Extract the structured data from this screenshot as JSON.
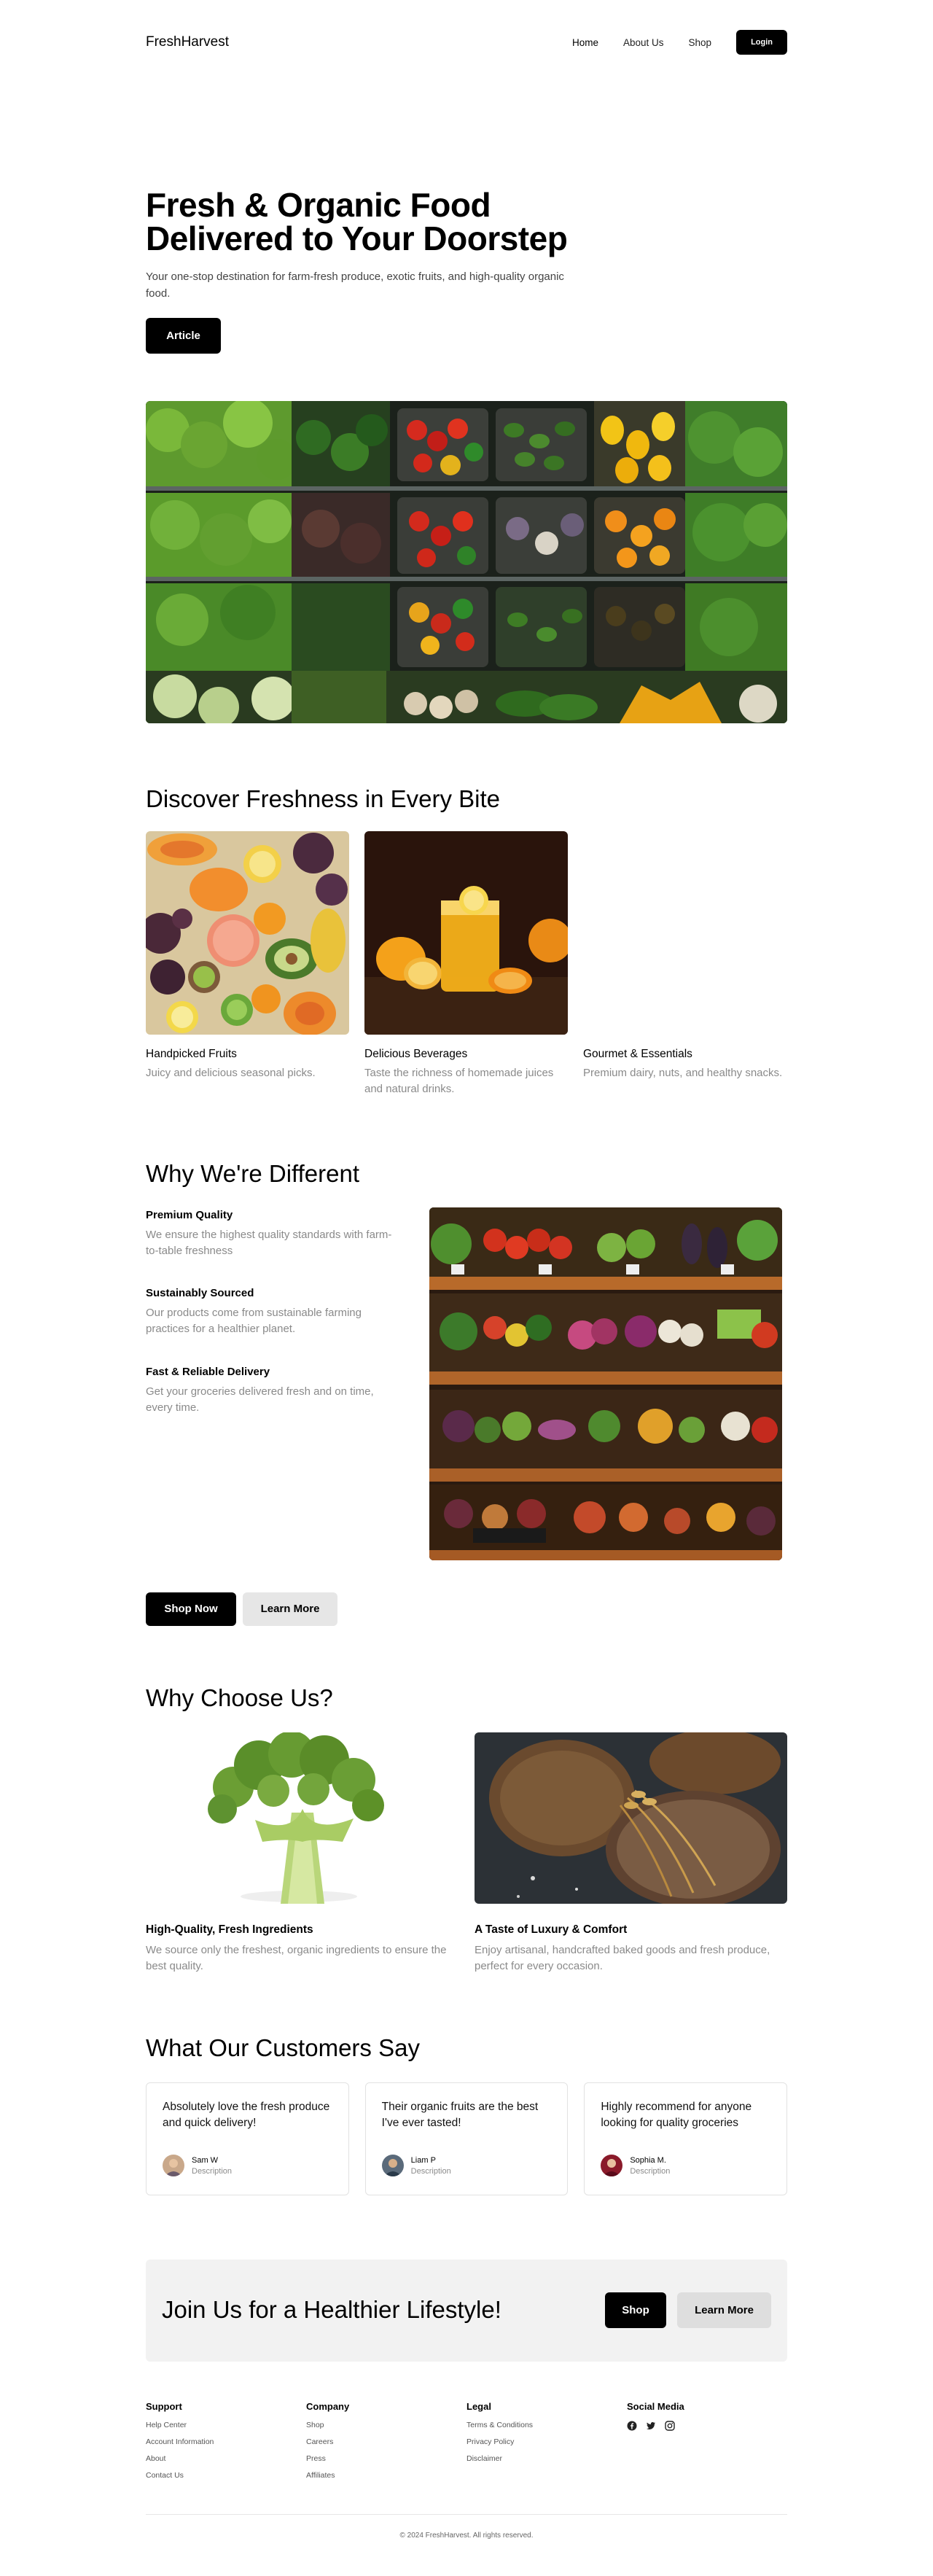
{
  "nav": {
    "brand": "FreshHarvest",
    "links": [
      "Home",
      "About Us",
      "Shop"
    ],
    "login": "Login"
  },
  "hero": {
    "title": "Fresh & Organic Food Delivered to Your Doorstep",
    "subtitle": "Your one-stop destination for farm-fresh produce, exotic fruits, and high-quality organic food.",
    "button": "Article"
  },
  "discover": {
    "heading": "Discover Freshness in Every Bite",
    "cards": [
      {
        "title": "Handpicked Fruits",
        "desc": "Juicy and delicious seasonal picks."
      },
      {
        "title": "Delicious Beverages",
        "desc": "Taste the richness of homemade juices and natural drinks."
      },
      {
        "title": "Gourmet & Essentials",
        "desc": "Premium dairy, nuts, and healthy snacks."
      }
    ]
  },
  "different": {
    "heading": "Why We're Different",
    "features": [
      {
        "title": "Premium Quality",
        "desc": "We ensure the highest quality standards with farm-to-table freshness"
      },
      {
        "title": "Sustainably Sourced",
        "desc": "Our products come from sustainable farming practices for a healthier planet."
      },
      {
        "title": "Fast & Reliable Delivery",
        "desc": "Get your groceries delivered fresh and on time, every time."
      }
    ],
    "shop_now": "Shop Now",
    "learn_more": "Learn More"
  },
  "choose": {
    "heading": "Why Choose Us?",
    "items": [
      {
        "title": "High-Quality, Fresh Ingredients",
        "desc": "We source only the freshest, organic ingredients to ensure the best quality."
      },
      {
        "title": "A Taste of Luxury & Comfort",
        "desc": "Enjoy artisanal, handcrafted baked goods and fresh produce, perfect for every occasion."
      }
    ]
  },
  "testimonials": {
    "heading": "What Our Customers Say",
    "items": [
      {
        "quote": "Absolutely love the fresh produce and quick delivery!",
        "name": "Sam W",
        "role": "Description"
      },
      {
        "quote": "Their organic fruits are the best I've ever tasted!",
        "name": "Liam P",
        "role": "Description"
      },
      {
        "quote": "Highly recommend for anyone looking for quality groceries",
        "name": "Sophia M.",
        "role": "Description"
      }
    ]
  },
  "cta": {
    "heading": "Join Us for a Healthier Lifestyle!",
    "shop": "Shop",
    "learn_more": "Learn More"
  },
  "footer": {
    "support": {
      "title": "Support",
      "links": [
        "Help Center",
        "Account Information",
        "About",
        "Contact Us"
      ]
    },
    "company": {
      "title": "Company",
      "links": [
        "Shop",
        "Careers",
        "Press",
        "Affiliates"
      ]
    },
    "legal": {
      "title": "Legal",
      "links": [
        "Terms & Conditions",
        "Privacy Policy",
        "Disclaimer"
      ]
    },
    "social": {
      "title": "Social Media",
      "icons": [
        "facebook-icon",
        "twitter-icon",
        "instagram-icon"
      ]
    },
    "copyright": "© 2024 FreshHarvest. All rights reserved."
  }
}
